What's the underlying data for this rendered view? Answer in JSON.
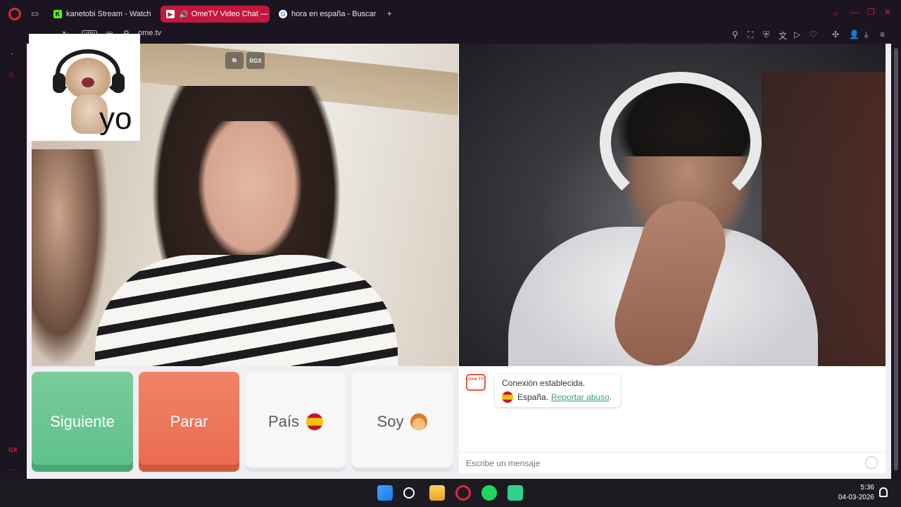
{
  "browser": {
    "tabs": [
      {
        "title": "kanetobi Stream - Watch L",
        "active": false
      },
      {
        "title": "OmeTV Video Chat —",
        "active": true
      },
      {
        "title": "hora en españa - Buscar c",
        "active": false
      }
    ],
    "new_tab_label": "+",
    "address": "ome.tv",
    "vpn_label": "VPN",
    "colors": {
      "accent": "#c4173b",
      "frame": "#1a1520"
    }
  },
  "video": {
    "overlay_buttons": [
      {
        "label": ""
      },
      {
        "label": "RGX"
      }
    ],
    "self_overlay_text": "yo"
  },
  "controls": {
    "next_label": "Siguiente",
    "stop_label": "Parar",
    "country_label": "País",
    "me_label": "Soy"
  },
  "chat": {
    "logo_text": "Ome TV",
    "status": "Conexión establecida.",
    "country": "España.",
    "report_label": "Reportar abuso",
    "report_suffix": ".",
    "input_placeholder": "Escribe un mensaje"
  },
  "taskbar": {
    "time": "5:36",
    "date": "04-03-2026"
  }
}
